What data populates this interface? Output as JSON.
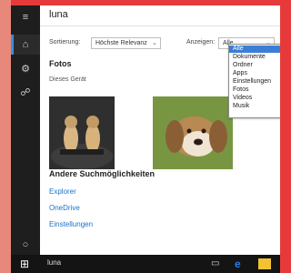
{
  "search": {
    "query": "luna"
  },
  "filters": {
    "sort_label": "Sortierung:",
    "sort_value": "Höchste Relevanz",
    "show_label": "Anzeigen:",
    "show_value": "Alle",
    "options": [
      "Alle",
      "Dokumente",
      "Ordner",
      "Apps",
      "Einstellungen",
      "Fotos",
      "Videos",
      "Musik"
    ]
  },
  "results": {
    "section_title": "Fotos",
    "section_sub": "Dieses Gerät"
  },
  "more": {
    "title": "Andere Suchmöglichkeiten",
    "links": [
      "Explorer",
      "OneDrive",
      "Einstellungen"
    ]
  },
  "taskbar": {
    "search_text": "luna"
  },
  "colors": {
    "accent": "#3b7ed8",
    "link": "#1a73c9",
    "rail": "#1e1e1e"
  },
  "icons": [
    "menu-icon",
    "home-icon",
    "settings-icon",
    "feedback-icon",
    "cortana-icon",
    "windows-icon",
    "task-view-icon",
    "edge-icon",
    "explorer-icon"
  ]
}
